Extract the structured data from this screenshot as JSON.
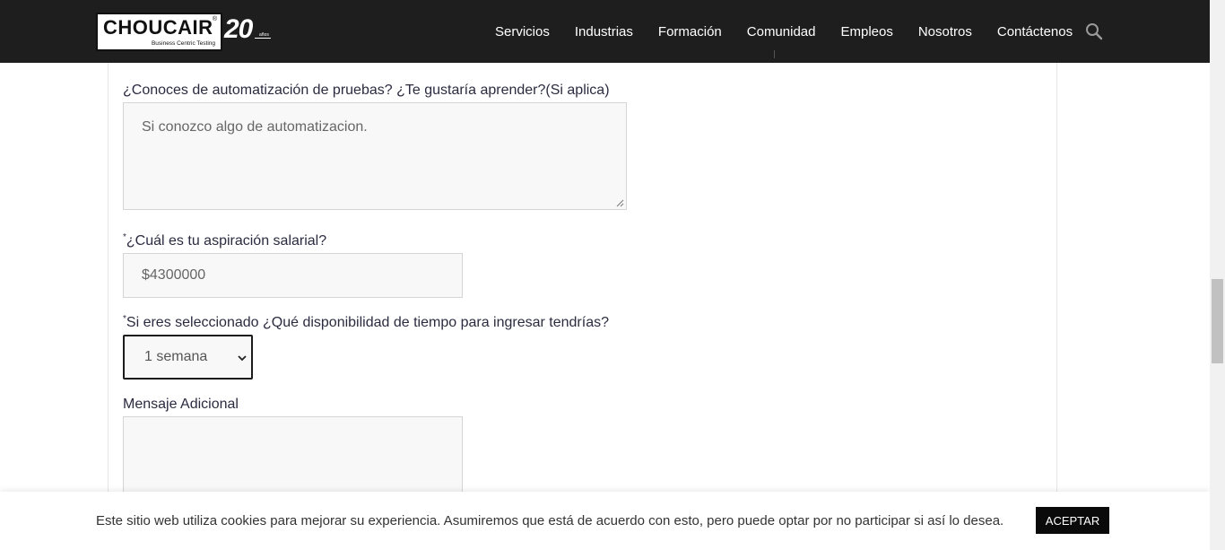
{
  "header": {
    "logo_word": "CHOUCAIR",
    "logo_tagline": "Business Centric Testing",
    "anniversary": "20",
    "anniversary_sub": "años",
    "nav": [
      "Servicios",
      "Industrias",
      "Formación",
      "Comunidad",
      "Empleos",
      "Nosotros",
      "Contáctenos"
    ],
    "search_icon": "search-icon"
  },
  "form": {
    "automation": {
      "label": "¿Conoces de automatización de pruebas? ¿Te gustaría aprender?(Si aplica)",
      "value": "Si conozco algo de automatizacion."
    },
    "salary": {
      "required_mark": "*",
      "label": "¿Cuál es tu aspiración salarial?",
      "value": "$4300000"
    },
    "availability": {
      "required_mark": "*",
      "label": "Si eres seleccionado ¿Qué disponibilidad de tiempo para ingresar tendrías?",
      "selected": "1 semana"
    },
    "message": {
      "label": "Mensaje Adicional",
      "value": ""
    }
  },
  "cookie": {
    "text": "Este sitio web utiliza cookies para mejorar su experiencia. Asumiremos que está de acuerdo con esto, pero puede optar por no participar si así lo desea.",
    "accept_label": "ACEPTAR"
  },
  "colors": {
    "header_bg": "#1e1e1e",
    "field_bg": "#f8f8f8",
    "accept_bg": "#0a0a0a"
  }
}
